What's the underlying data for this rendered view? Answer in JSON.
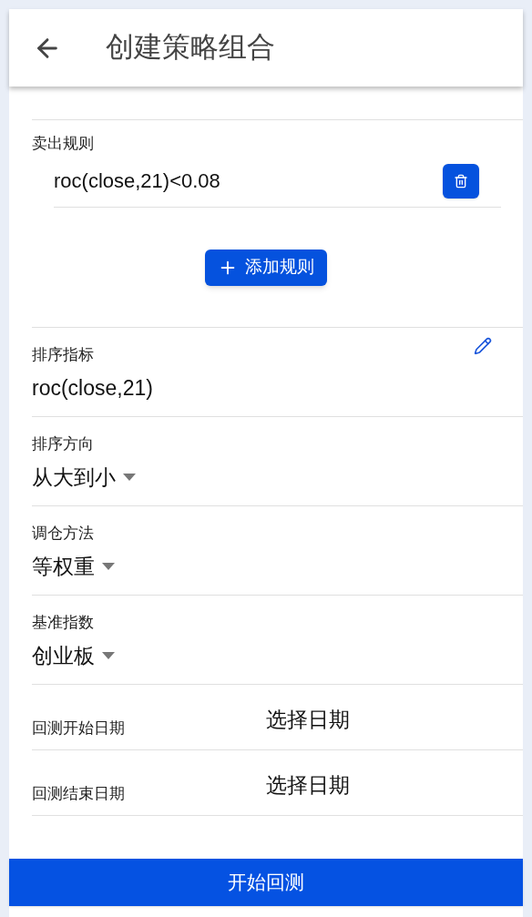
{
  "header": {
    "title": "创建策略组合"
  },
  "sell_rules": {
    "label": "卖出规则",
    "rules": [
      "roc(close,21)<0.08"
    ],
    "add_button": "添加规则"
  },
  "fields": [
    {
      "kind": "editable",
      "label": "排序指标",
      "value": "roc(close,21)"
    },
    {
      "kind": "dropdown",
      "label": "排序方向",
      "value": "从大到小"
    },
    {
      "kind": "dropdown",
      "label": "调仓方法",
      "value": "等权重"
    },
    {
      "kind": "dropdown",
      "label": "基准指数",
      "value": "创业板"
    },
    {
      "kind": "date",
      "label": "回测开始日期",
      "value": "选择日期"
    },
    {
      "kind": "date",
      "label": "回测结束日期",
      "value": "选择日期"
    }
  ],
  "submit_button": "开始回测"
}
